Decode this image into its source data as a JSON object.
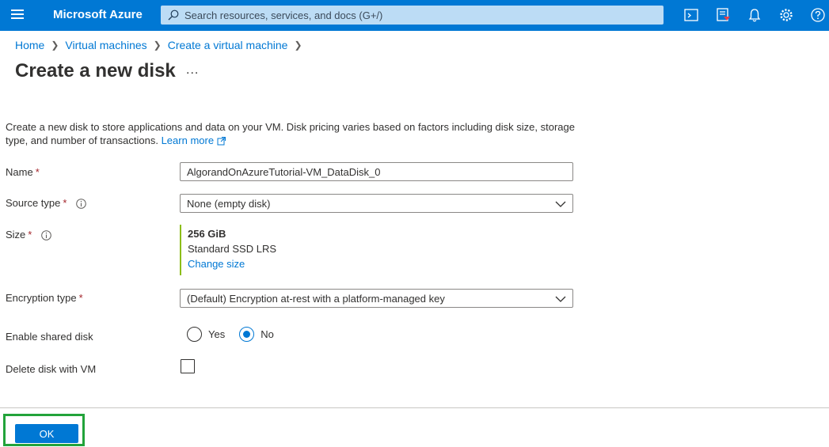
{
  "topbar": {
    "brand": "Microsoft Azure",
    "search_placeholder": "Search resources, services, and docs (G+/)",
    "icons": [
      "menu-icon",
      "search-icon",
      "cloud-shell-icon",
      "directory-filter-icon",
      "notifications-icon",
      "settings-icon",
      "help-icon"
    ]
  },
  "breadcrumb": [
    "Home",
    "Virtual machines",
    "Create a virtual machine"
  ],
  "page": {
    "title": "Create a new disk",
    "more": "...",
    "description": "Create a new disk to store applications and data on your VM. Disk pricing varies based on factors including disk size, storage type, and number of transactions.",
    "learn_more": "Learn more"
  },
  "form": {
    "name_label": "Name",
    "name_value": "AlgorandOnAzureTutorial-VM_DataDisk_0",
    "source_label": "Source type",
    "source_value": "None (empty disk)",
    "size_label": "Size",
    "size_value": "256 GiB",
    "size_tier": "Standard SSD LRS",
    "size_change": "Change size",
    "encryption_label": "Encryption type",
    "encryption_value": "(Default) Encryption at-rest with a platform-managed key",
    "shared_label": "Enable shared disk",
    "shared_yes": "Yes",
    "shared_no": "No",
    "shared_selected": "No",
    "delete_label": "Delete disk with VM",
    "delete_checked": false,
    "required_mark": "*"
  },
  "footer": {
    "ok": "OK"
  },
  "colors": {
    "brand": "#0078d4",
    "accent_bar": "#8cbd18",
    "highlight": "#22a33a",
    "required": "#a4262c"
  }
}
